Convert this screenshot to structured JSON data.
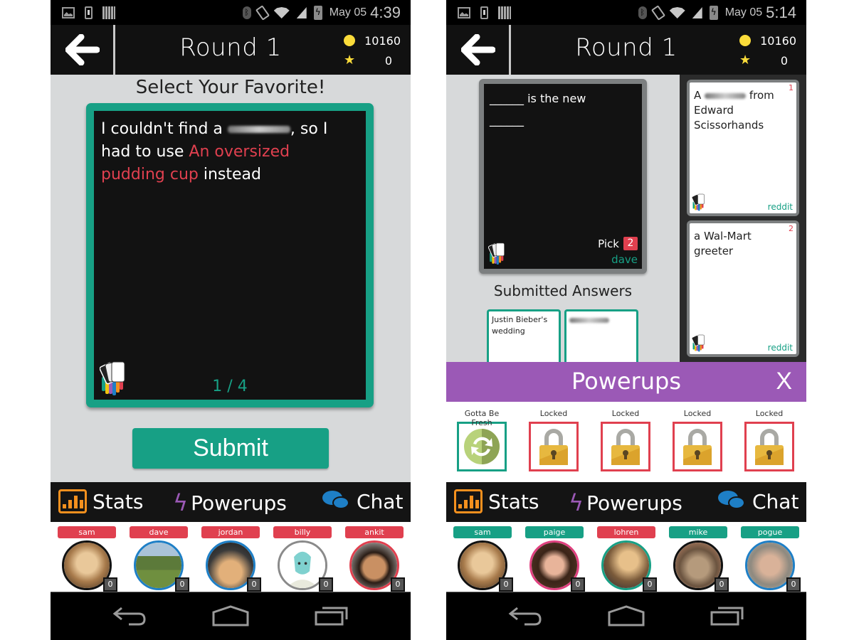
{
  "screens": [
    {
      "status": {
        "date": "May 05",
        "time": "4:39"
      },
      "header": {
        "title": "Round 1",
        "coins": "10160",
        "stars": "0"
      },
      "select_title": "Select Your Favorite!",
      "card": {
        "text_before": "I couldn't find a",
        "text_after_redacted": ", so I had to use",
        "answer": "An oversized pudding cup",
        "text_end": "instead",
        "counter": "1 / 4"
      },
      "submit_label": "Submit",
      "tabs": [
        {
          "label": "Stats",
          "icon": "bar-chart-icon"
        },
        {
          "label": "Powerups",
          "icon": "lightning-icon"
        },
        {
          "label": "Chat",
          "icon": "chat-bubbles-icon"
        }
      ],
      "players": [
        {
          "name": "sam",
          "score": "0",
          "tag_color": "#e0404f",
          "ring_color": "#111111"
        },
        {
          "name": "dave",
          "score": "0",
          "tag_color": "#e0404f",
          "ring_color": "#1e7fc6"
        },
        {
          "name": "jordan",
          "score": "0",
          "tag_color": "#e0404f",
          "ring_color": "#1e7fc6"
        },
        {
          "name": "billy",
          "score": "0",
          "tag_color": "#e0404f",
          "ring_color": "#8a8a8a"
        },
        {
          "name": "ankit",
          "score": "0",
          "tag_color": "#e0404f",
          "ring_color": "#e0404f"
        }
      ]
    },
    {
      "status": {
        "date": "May 05",
        "time": "5:14"
      },
      "header": {
        "title": "Round 1",
        "coins": "10160",
        "stars": "0"
      },
      "prompt": {
        "line1": "______ is the new",
        "line2": "______",
        "pick_label": "Pick",
        "pick_count": "2",
        "author": "dave"
      },
      "submitted_title": "Submitted Answers",
      "submitted": [
        {
          "text": "Justin Bieber's wedding"
        },
        {
          "text": ""
        }
      ],
      "hand": [
        {
          "text_before": "A",
          "text_after": "from Edward Scissorhands",
          "number": "1",
          "source": "reddit"
        },
        {
          "text": "a Wal-Mart greeter",
          "number": "2",
          "source": "reddit"
        }
      ],
      "powerups": {
        "title": "Powerups",
        "close": "X",
        "items": [
          {
            "label": "Gotta Be Fresh",
            "icon": "refresh-icon",
            "state": "available"
          },
          {
            "label": "Locked",
            "icon": "lock-icon",
            "state": "locked"
          },
          {
            "label": "Locked",
            "icon": "lock-icon",
            "state": "locked"
          },
          {
            "label": "Locked",
            "icon": "lock-icon",
            "state": "locked"
          },
          {
            "label": "Locked",
            "icon": "lock-icon",
            "state": "locked"
          }
        ]
      },
      "tabs": [
        {
          "label": "Stats",
          "icon": "bar-chart-icon"
        },
        {
          "label": "Powerups",
          "icon": "lightning-icon"
        },
        {
          "label": "Chat",
          "icon": "chat-bubbles-icon"
        }
      ],
      "players": [
        {
          "name": "sam",
          "score": "0",
          "tag_color": "#17a085",
          "ring_color": "#111111"
        },
        {
          "name": "paige",
          "score": "0",
          "tag_color": "#17a085",
          "ring_color": "#e0407f"
        },
        {
          "name": "lohren",
          "score": "0",
          "tag_color": "#e0404f",
          "ring_color": "#17a085"
        },
        {
          "name": "mike",
          "score": "0",
          "tag_color": "#17a085",
          "ring_color": "#111111"
        },
        {
          "name": "pogue",
          "score": "0",
          "tag_color": "#17a085",
          "ring_color": "#1e7fc6"
        }
      ]
    }
  ],
  "colors": {
    "accent": "#17a085",
    "danger": "#e0404f",
    "powerups": "#9b59b6",
    "coin": "#fbdc3a"
  }
}
